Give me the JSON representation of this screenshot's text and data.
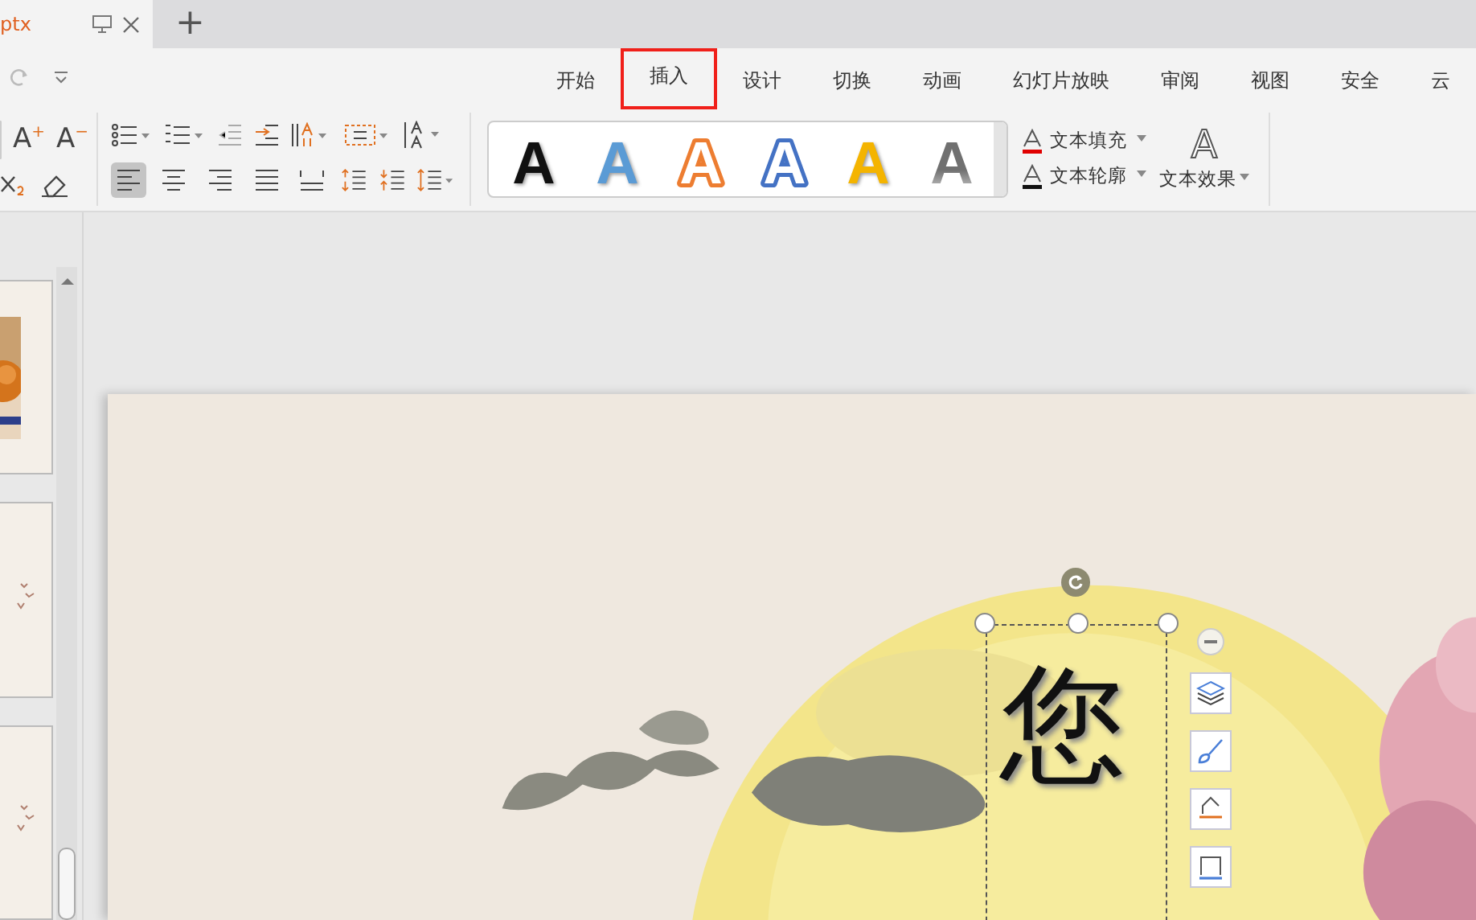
{
  "document_tab": {
    "title": "ptx"
  },
  "new_tab": {
    "label": "+"
  },
  "menu_tabs": [
    {
      "label": "开始",
      "highlighted": false
    },
    {
      "label": "插入",
      "highlighted": true
    },
    {
      "label": "设计",
      "highlighted": false
    },
    {
      "label": "切换",
      "highlighted": false
    },
    {
      "label": "动画",
      "highlighted": false
    },
    {
      "label": "幻灯片放映",
      "highlighted": false
    },
    {
      "label": "审阅",
      "highlighted": false
    },
    {
      "label": "视图",
      "highlighted": false
    },
    {
      "label": "安全",
      "highlighted": false
    },
    {
      "label": "云",
      "highlighted": false
    }
  ],
  "font_buttons": [
    {
      "label": "A",
      "sign": "+"
    },
    {
      "label": "A",
      "sign": "−"
    }
  ],
  "align_buttons": [
    {
      "selected": true
    },
    {
      "selected": false
    },
    {
      "selected": false
    },
    {
      "selected": false
    },
    {
      "selected": false
    }
  ],
  "wordart_styles": [
    {
      "label": "A",
      "kind": "solid",
      "color": "#111111"
    },
    {
      "label": "A",
      "kind": "solid",
      "color": "#5b9bd5"
    },
    {
      "label": "A",
      "kind": "outline"
    },
    {
      "label": "A",
      "kind": "outline"
    },
    {
      "label": "A",
      "kind": "solid",
      "color": "#f4b400"
    },
    {
      "label": "A",
      "kind": "gradient"
    }
  ],
  "text_fill": {
    "label": "文本填充"
  },
  "text_outline": {
    "label": "文本轮廓"
  },
  "text_effect": {
    "label": "文本效果",
    "icon": "A"
  },
  "thumbnails": [
    {
      "kind": "picture"
    },
    {
      "kind": "plain"
    },
    {
      "kind": "plain"
    }
  ],
  "slide": {
    "vertical_text": "您"
  }
}
